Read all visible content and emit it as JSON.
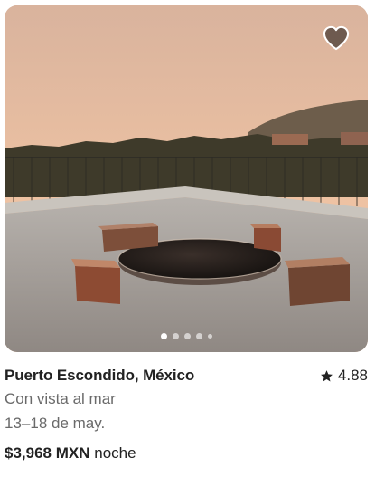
{
  "listing": {
    "title": "Puerto Escondido, México",
    "rating": "4.88",
    "subtitle": "Con vista al mar",
    "dates": "13–18 de may.",
    "price": "$3,968 MXN",
    "price_unit": "noche"
  },
  "carousel": {
    "active_index": 0,
    "dot_count": 5
  },
  "icons": {
    "favorite": "heart-icon",
    "rating": "star-icon"
  },
  "colors": {
    "text_primary": "#222222",
    "text_secondary": "#6a6a6a",
    "heart_fill": "rgba(0,0,0,0.5)"
  }
}
